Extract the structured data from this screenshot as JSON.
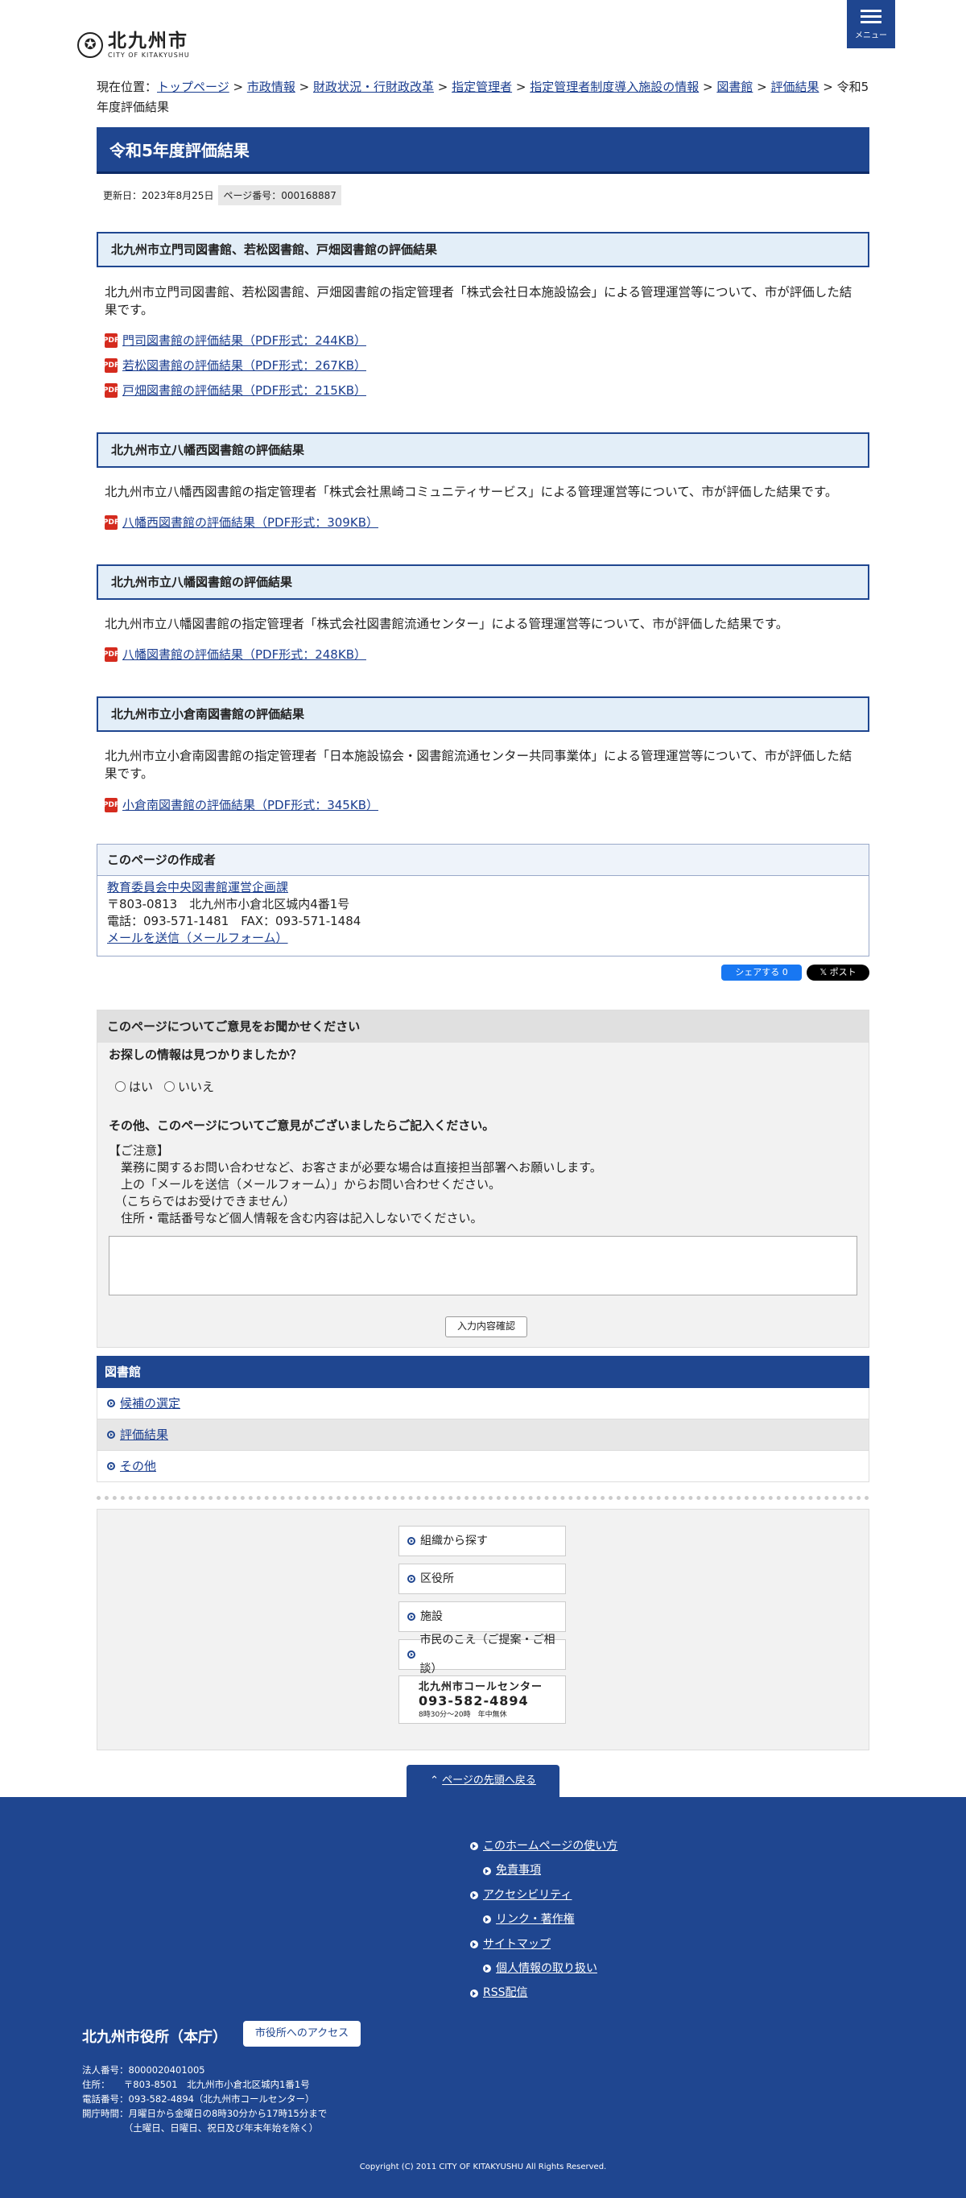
{
  "header": {
    "logo_mark": "✪",
    "logo_jp": "北九州市",
    "logo_en": "CITY OF KITAKYUSHU",
    "menu_label": "メニュー"
  },
  "breadcrumb": {
    "prefix": "現在位置：",
    "items": [
      "トップページ",
      "市政情報",
      "財政状況・行財政改革",
      "指定管理者",
      "指定管理者制度導入施設の情報",
      "図書館",
      "評価結果"
    ],
    "separator": " > ",
    "current": "令和5年度評価結果"
  },
  "page": {
    "title": "令和5年度評価結果",
    "updated": "更新日：2023年8月25日",
    "page_number": "ページ番号：000168887"
  },
  "sections": [
    {
      "heading": "北九州市立門司図書館、若松図書館、戸畑図書館の評価結果",
      "body": "北九州市立門司図書館、若松図書館、戸畑図書館の指定管理者「株式会社日本施設協会」による管理運営等について、市が評価した結果です。",
      "links": [
        "門司図書館の評価結果（PDF形式：244KB）",
        "若松図書館の評価結果（PDF形式：267KB）",
        "戸畑図書館の評価結果（PDF形式：215KB）"
      ]
    },
    {
      "heading": "北九州市立八幡西図書館の評価結果",
      "body": "北九州市立八幡西図書館の指定管理者「株式会社黒崎コミュニティサービス」による管理運営等について、市が評価した結果です。",
      "links": [
        "八幡西図書館の評価結果（PDF形式：309KB）"
      ]
    },
    {
      "heading": "北九州市立八幡図書館の評価結果",
      "body": "北九州市立八幡図書館の指定管理者「株式会社図書館流通センター」による管理運営等について、市が評価した結果です。",
      "links": [
        "八幡図書館の評価結果（PDF形式：248KB）"
      ]
    },
    {
      "heading": "北九州市立小倉南図書館の評価結果",
      "body": "北九州市立小倉南図書館の指定管理者「日本施設協会・図書館流通センター共同事業体」による管理運営等について、市が評価した結果です。",
      "links": [
        "小倉南図書館の評価結果（PDF形式：345KB）"
      ]
    }
  ],
  "pdf_icon_text": "PDF",
  "author": {
    "heading": "このページの作成者",
    "dept": "教育委員会中央図書館運営企画課",
    "address": "〒803-0813　北九州市小倉北区城内4番1号",
    "phone": "電話：093-571-1481　FAX：093-571-1484",
    "mail": "メールを送信（メールフォーム）"
  },
  "share": {
    "facebook": "シェアする 0",
    "x": "𝕏 ポスト"
  },
  "feedback": {
    "heading": "このページについてご意見をお聞かせください",
    "q1": "お探しの情報は見つかりましたか？",
    "yes": "はい",
    "no": "いいえ",
    "q2": "その他、このページについてご意見がございましたらご記入ください。",
    "notes": [
      "【ご注意】",
      "　業務に関するお問い合わせなど、お客さまが必要な場合は直接担当部署へお願いします。",
      "　上の「メールを送信（メールフォーム）」からお問い合わせください。",
      "　（こちらではお受けできません）",
      "　住所・電話番号など個人情報を含む内容は記入しないでください。"
    ],
    "confirm": "入力内容確認"
  },
  "library_nav": {
    "heading": "図書館",
    "items": [
      "候補の選定",
      "評価結果",
      "その他"
    ]
  },
  "guide": {
    "buttons": [
      "組織から探す",
      "区役所",
      "施設",
      "市民のこえ（ご提案・ご相談）"
    ],
    "callcenter_name": "北九州市コールセンター",
    "callcenter_tel": "093-582-4894",
    "callcenter_hours": "8時30分〜20時　年中無休"
  },
  "to_top": "ページの先頭へ戻る",
  "footer": {
    "links": [
      {
        "label": "このホームページの使い方",
        "sub": false
      },
      {
        "label": "免責事項",
        "sub": true
      },
      {
        "label": "アクセシビリティ",
        "sub": false
      },
      {
        "label": "リンク・著作権",
        "sub": true
      },
      {
        "label": "サイトマップ",
        "sub": false
      },
      {
        "label": "個人情報の取り扱い",
        "sub": true
      },
      {
        "label": "RSS配信",
        "sub": false
      }
    ],
    "office": "北九州市役所（本庁）",
    "access": "市役所へのアクセス",
    "info": [
      "法人番号：8000020401005",
      "住所：　　〒803-8501　北九州市小倉北区城内1番1号",
      "電話番号：093-582-4894（北九州市コールセンター）",
      "開庁時間：月曜日から金曜日の8時30分から17時15分まで",
      "　　　　　（土曜日、日曜日、祝日及び年末年始を除く）"
    ],
    "copyright": "Copyright (C) 2011 CITY OF KITAKYUSHU All Rights Reserved."
  }
}
